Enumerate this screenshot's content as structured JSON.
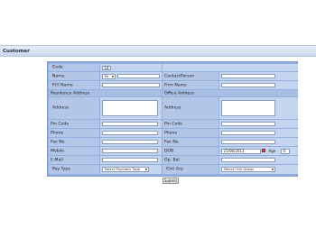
{
  "header": {
    "title": "Customer"
  },
  "form": {
    "code": {
      "label": "Code",
      "value": "14"
    },
    "name": {
      "label": "Name",
      "title_value": "Mr"
    },
    "contact_person": {
      "label": "ContactPerson"
    },
    "fh_name": {
      "label": "F/H Name"
    },
    "firm_name": {
      "label": "Firm Name"
    },
    "residence_section": "Residence Address",
    "office_section": "Office Address",
    "res_address": {
      "label": "Address"
    },
    "off_address": {
      "label": "Address"
    },
    "res_pin": {
      "label": "Pin Code"
    },
    "off_pin": {
      "label": "Pin Code"
    },
    "res_phone": {
      "label": "Phone"
    },
    "off_phone": {
      "label": "Phone"
    },
    "res_fax": {
      "label": "Fax No."
    },
    "off_fax": {
      "label": "Fax No."
    },
    "mobile": {
      "label": "Mobile"
    },
    "dob": {
      "label": "DOB",
      "value": "21/06/2013"
    },
    "age": {
      "label": "Age",
      "value": "0"
    },
    "email": {
      "label": "E-Mail"
    },
    "op_bal": {
      "label": "Op. Bal"
    },
    "pay_type": {
      "label": "Pay Type",
      "value": "Select Payment Type"
    },
    "chit_grp": {
      "label": "Chit Grp",
      "value": "Select Chit Group"
    },
    "required_mark": "*",
    "submit_label": "Submit"
  }
}
